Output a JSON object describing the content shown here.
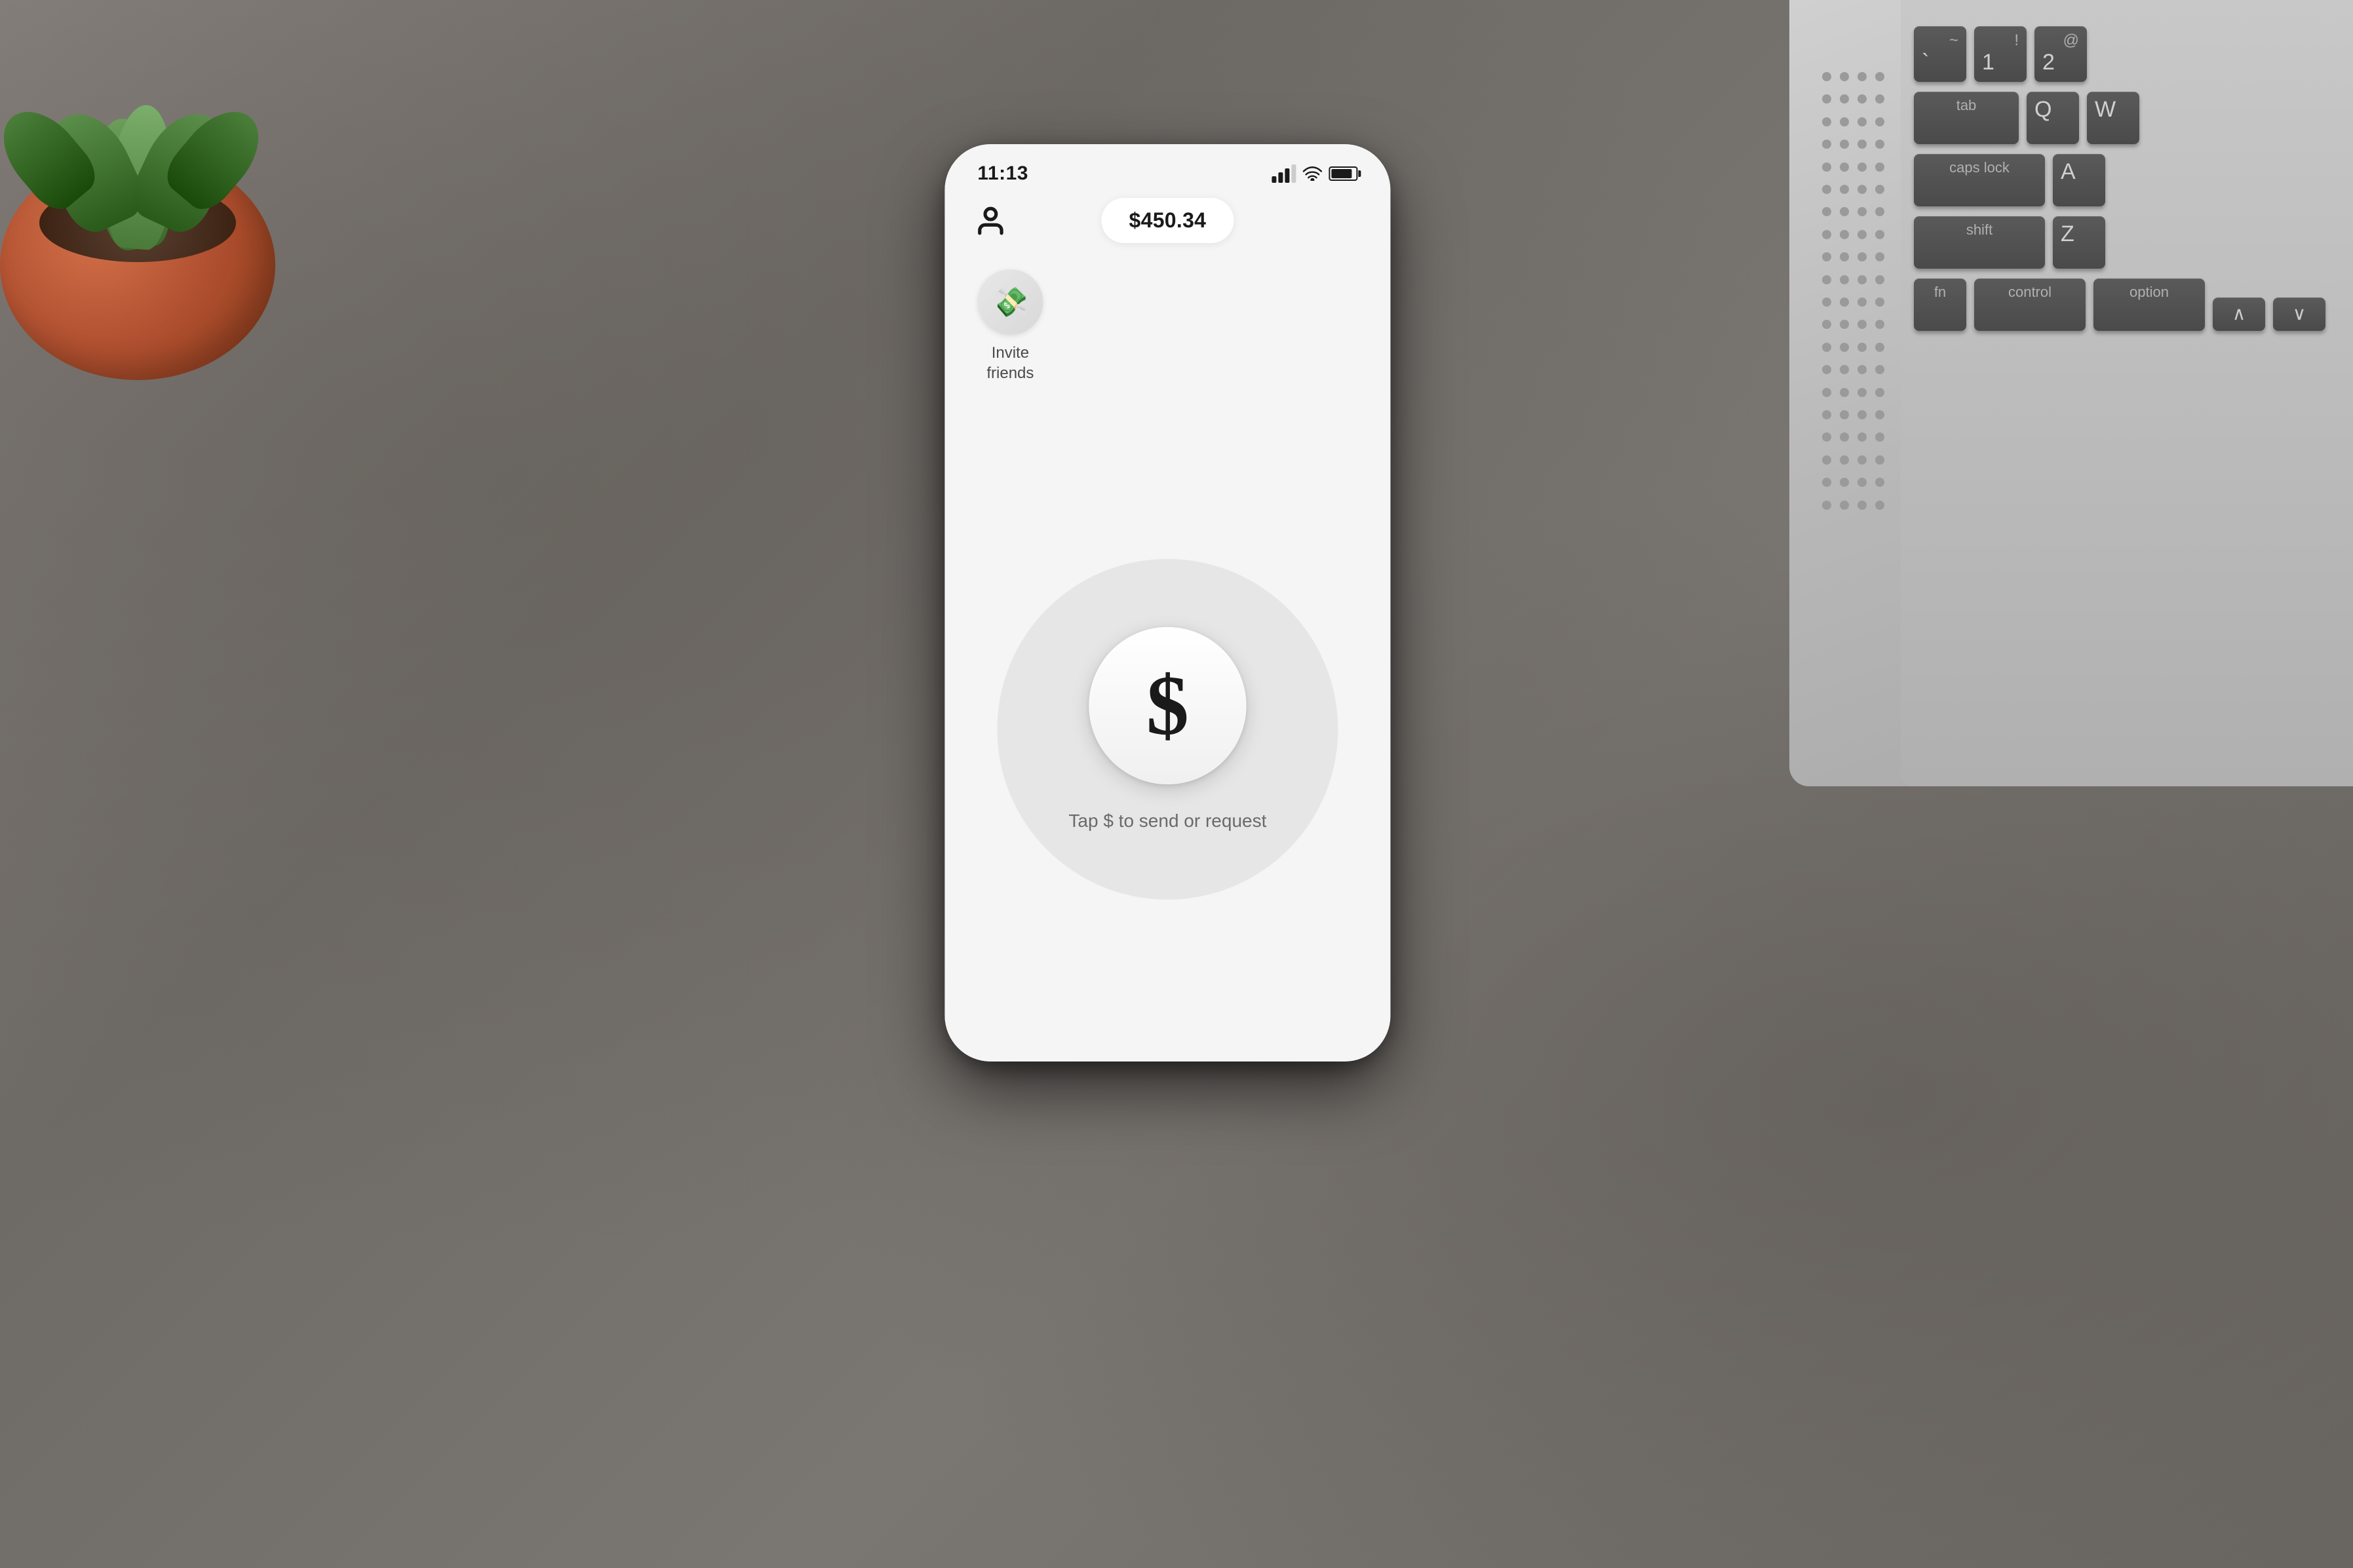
{
  "background": {
    "color": "#7a7570"
  },
  "phone": {
    "status_bar": {
      "time": "11:13",
      "signal_bars": 3,
      "wifi": true,
      "battery_percent": 85
    },
    "app": {
      "balance": "$450.34",
      "invite_friends_label": "Invite friends",
      "invite_friends_emoji": "💸",
      "dollar_symbol": "$",
      "tap_hint": "Tap $ to send or request"
    }
  },
  "keyboard": {
    "rows": [
      [
        {
          "top": "~",
          "main": "`"
        },
        {
          "top": "!",
          "main": "1"
        },
        {
          "top": "@",
          "main": "2"
        }
      ],
      [
        {
          "label": "tab"
        },
        {
          "top": "",
          "main": "Q"
        },
        {
          "top": "",
          "main": "W"
        }
      ],
      [
        {
          "label": "caps lock"
        },
        {
          "top": "",
          "main": "A"
        }
      ],
      [
        {
          "label": "shift"
        },
        {
          "top": "",
          "main": "Z"
        }
      ],
      [
        {
          "label": "fn"
        },
        {
          "label": "control"
        },
        {
          "label": "option"
        }
      ]
    ]
  },
  "plant": {
    "emoji": "🌵"
  }
}
